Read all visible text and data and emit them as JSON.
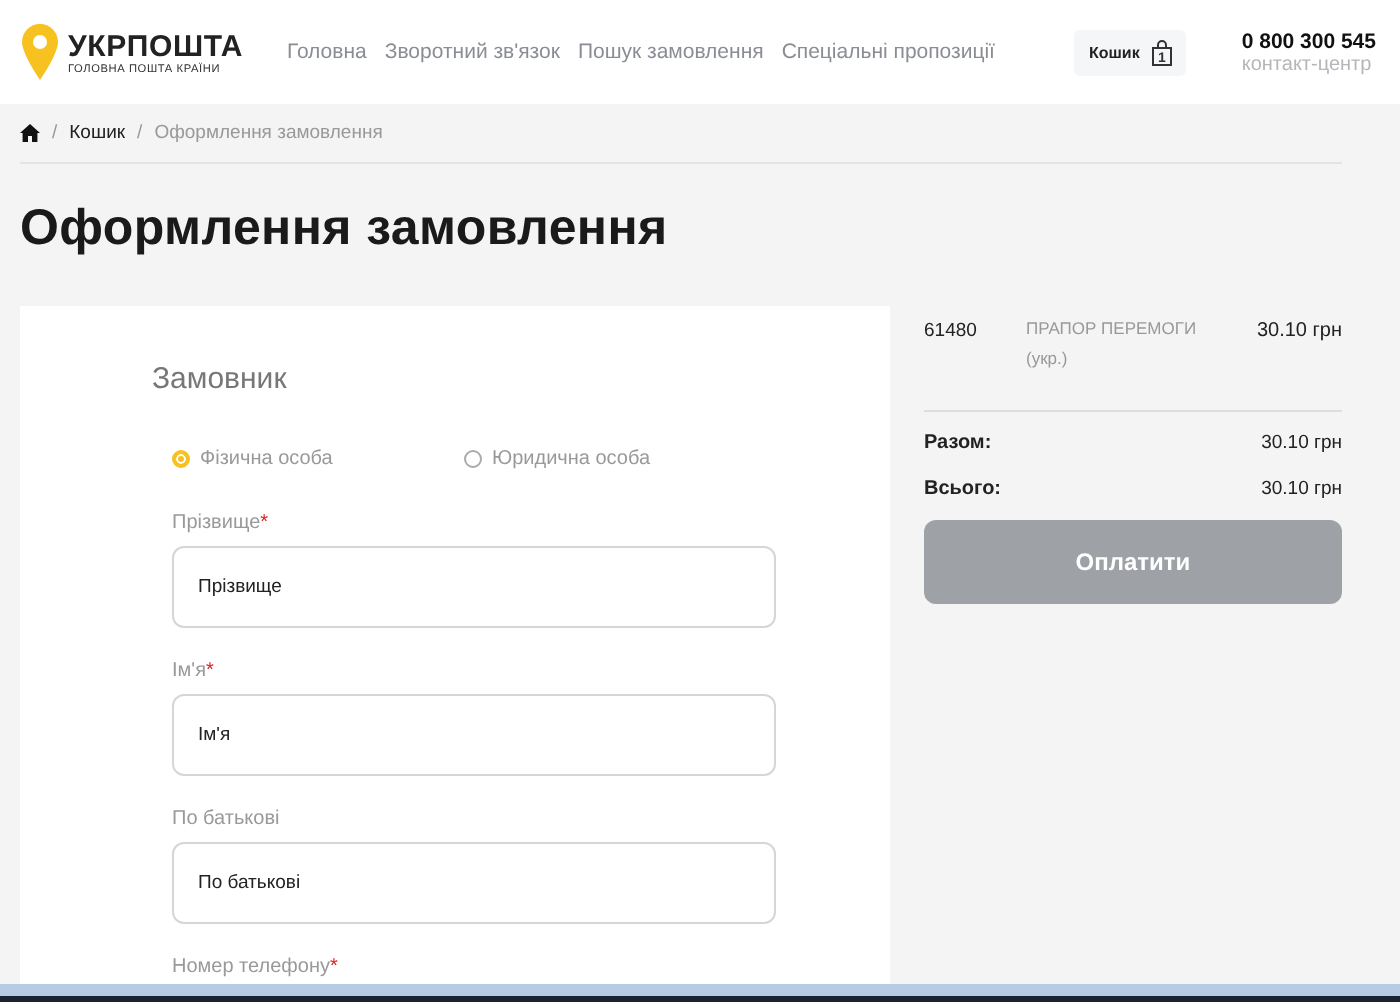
{
  "header": {
    "logo_title": "УКРПОШТА",
    "logo_subtitle": "ГОЛОВНА ПОШТА КРАЇНИ",
    "nav": [
      {
        "label": "Головна"
      },
      {
        "label": "Зворотний зв'язок"
      },
      {
        "label": "Пошук замовлення"
      },
      {
        "label": "Спеціальні пропозиції"
      }
    ],
    "cart": {
      "label": "Кошик",
      "count": "1"
    },
    "phone": "0 800 300 545",
    "phone_caption": "контакт-центр"
  },
  "breadcrumb": [
    {
      "separator": "/",
      "label": "Кошик"
    },
    {
      "separator": "/",
      "label": "Оформлення замовлення"
    }
  ],
  "page_title": "Оформлення замовлення",
  "form": {
    "section_title": "Замовник",
    "customer_types": [
      {
        "label": "Фізична особа",
        "selected": true
      },
      {
        "label": "Юридична особа",
        "selected": false
      }
    ],
    "fields": [
      {
        "label": "Прізвище",
        "required_mark": "*",
        "placeholder": "Прізвище"
      },
      {
        "label": "Ім'я",
        "required_mark": "*",
        "placeholder": "Ім'я"
      },
      {
        "label": "По батькові",
        "placeholder": "По батькові"
      },
      {
        "label": "Номер телефону",
        "required_mark": "*"
      }
    ]
  },
  "summary": {
    "items": [
      {
        "code": "61480",
        "name": "ПРАПОР ПЕРЕМОГИ (укр.)",
        "price": "30.10 грн"
      }
    ],
    "totals": [
      {
        "label": "Разом:",
        "value": "30.10 грн"
      },
      {
        "label": "Всього:",
        "value": "30.10 грн"
      }
    ],
    "pay_button": {
      "label": "Оплатити",
      "disabled": true
    }
  }
}
